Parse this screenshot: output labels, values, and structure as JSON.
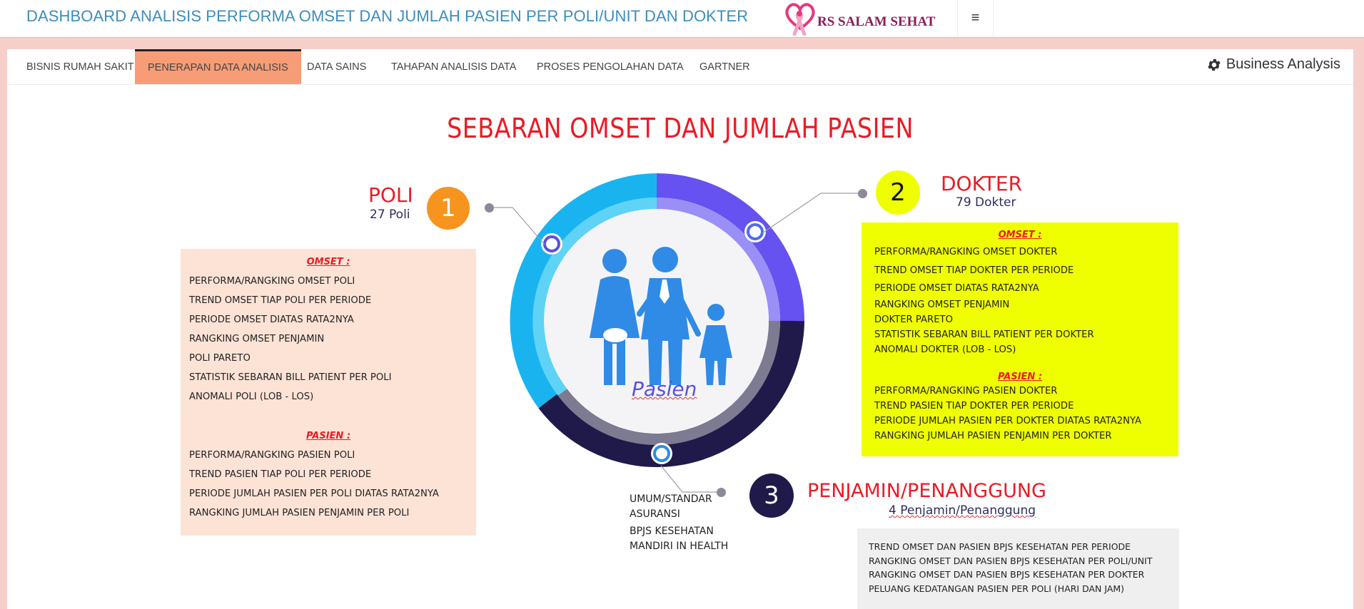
{
  "header": {
    "title": "DASHBOARD ANALISIS PERFORMA OMSET DAN JUMLAH PASIEN PER POLI/UNIT DAN DOKTER",
    "logo_text": "RS SALAM SEHAT",
    "menu_icon": "hamburger-icon"
  },
  "tabs": [
    {
      "label": "BISNIS RUMAH SAKIT"
    },
    {
      "label": "PENERAPAN DATA ANALISIS"
    },
    {
      "label": "DATA SAINS"
    },
    {
      "label": "TAHAPAN ANALISIS DATA"
    },
    {
      "label": "PROSES PENGOLAHAN DATA"
    },
    {
      "label": "GARTNER"
    }
  ],
  "active_tab": "PENERAPAN DATA ANALISIS",
  "brand_right": {
    "icon": "gear-icon",
    "label": "Business Analysis"
  },
  "infographic": {
    "title": "SEBARAN OMSET DAN JUMLAH PASIEN",
    "center_label": "Pasien",
    "poli": {
      "number": "1",
      "title": "POLI",
      "subtitle": "27 Poli",
      "omset_heading": "OMSET :",
      "omset_items": [
        "PERFORMA/RANGKING OMSET POLI",
        "TREND OMSET TIAP POLI PER PERIODE",
        "PERIODE OMSET DIATAS RATA2NYA",
        "RANGKING OMSET PENJAMIN",
        "POLI PARETO",
        "STATISTIK SEBARAN BILL PATIENT PER POLI",
        "ANOMALI POLI (LOB - LOS)"
      ],
      "pasien_heading": "PASIEN :",
      "pasien_items": [
        "PERFORMA/RANGKING PASIEN POLI",
        "TREND PASIEN TIAP POLI PER PERIODE",
        "PERIODE JUMLAH PASIEN PER POLI DIATAS RATA2NYA",
        "RANGKING JUMLAH PASIEN PENJAMIN PER POLI"
      ]
    },
    "dokter": {
      "number": "2",
      "title": "DOKTER",
      "subtitle": "79 Dokter",
      "omset_heading": "OMSET :",
      "omset_items": [
        "PERFORMA/RANGKING OMSET DOKTER",
        "TREND OMSET TIAP DOKTER PER PERIODE",
        "PERIODE OMSET DIATAS RATA2NYA",
        "RANGKING OMSET PENJAMIN",
        "DOKTER PARETO",
        "STATISTIK SEBARAN BILL PATIENT PER DOKTER",
        "ANOMALI DOKTER (LOB - LOS)"
      ],
      "pasien_heading": "PASIEN :",
      "pasien_items": [
        "PERFORMA/RANGKING PASIEN DOKTER",
        "TREND PASIEN TIAP DOKTER PER PERIODE",
        "PERIODE JUMLAH PASIEN PER DOKTER DIATAS RATA2NYA",
        "RANGKING JUMLAH PASIEN PENJAMIN PER DOKTER"
      ]
    },
    "penjamin": {
      "number": "3",
      "title": "PENJAMIN/PENANGGUNG",
      "subtitle": "4 Penjamin/Penanggung",
      "list": [
        "UMUM/STANDAR",
        "ASURANSI",
        "BPJS KESEHATAN",
        "MANDIRI IN HEALTH"
      ],
      "items": [
        "TREND OMSET DAN PASIEN BPJS KESEHATAN PER PERIODE",
        "RANGKING OMSET DAN PASIEN BPJS KESEHATAN PER POLI/UNIT",
        "RANGKING OMSET DAN PASIEN BPJS KESEHATAN PER DOKTER",
        "PELUANG KEDATANGAN PASIEN PER POLI (HARI DAN JAM)"
      ]
    },
    "colors": {
      "title_red": "#ea1b24",
      "poli_box": "#fde3d6",
      "dokter_box": "#f0ff00",
      "penjamin_box": "#efefef",
      "badge_orange": "#f7941d",
      "badge_yellow": "#f0ff00",
      "badge_navy": "#1f1a4a"
    }
  }
}
